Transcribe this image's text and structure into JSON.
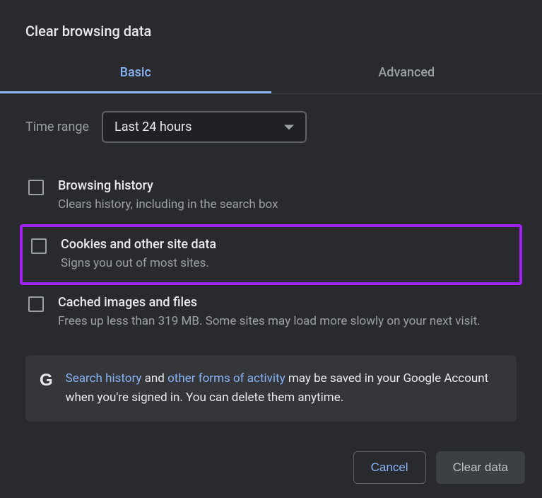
{
  "dialog": {
    "title": "Clear browsing data"
  },
  "tabs": {
    "basic": "Basic",
    "advanced": "Advanced"
  },
  "timeRange": {
    "label": "Time range",
    "selected": "Last 24 hours"
  },
  "options": [
    {
      "title": "Browsing history",
      "desc": "Clears history, including in the search box"
    },
    {
      "title": "Cookies and other site data",
      "desc": "Signs you out of most sites."
    },
    {
      "title": "Cached images and files",
      "desc": "Frees up less than 319 MB. Some sites may load more slowly on your next visit."
    }
  ],
  "info": {
    "link1": "Search history",
    "mid1": " and ",
    "link2": "other forms of activity",
    "rest": " may be saved in your Google Account when you're signed in. You can delete them anytime."
  },
  "buttons": {
    "cancel": "Cancel",
    "clear": "Clear data"
  }
}
